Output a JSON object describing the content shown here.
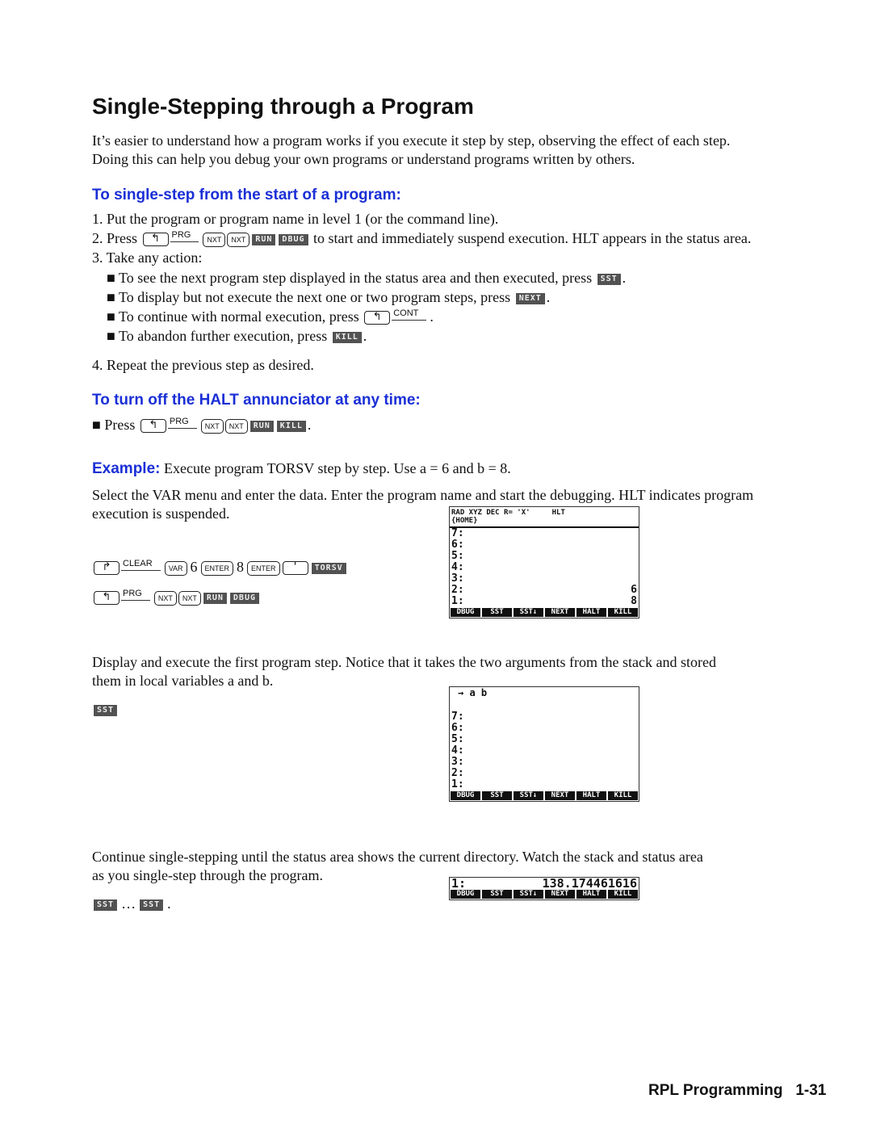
{
  "title": "Single-Stepping through a Program",
  "intro": [
    "It’s easier to understand how a program works if you execute it step by step, observing the effect of each step.",
    "Doing this can help you debug your own programs or understand programs written by others."
  ],
  "section1": {
    "heading": "To single-step from the start of a program:",
    "step1": "1. Put the program or program name in level 1 (or the command line).",
    "step2_pre": "2. Press",
    "step2_keys": [
      {
        "t": "shift",
        "v": "↰"
      },
      {
        "t": "label",
        "v": "PRG"
      },
      {
        "t": "key",
        "v": "NXT"
      },
      {
        "t": "key",
        "v": "NXT"
      },
      {
        "t": "soft",
        "v": "RUN"
      },
      {
        "t": "soft",
        "v": "DBUG"
      }
    ],
    "step2_post": "to start and immediately suspend execution. HLT appears in the status area.",
    "step3": "3. Take any action:",
    "bullets": [
      {
        "pre": "■ To see the next program step displayed in the status area and then executed, press",
        "keys": [
          {
            "t": "soft",
            "v": "SST"
          }
        ],
        "post": "."
      },
      {
        "pre": "■ To display but not execute the next one or two program steps, press",
        "keys": [
          {
            "t": "soft",
            "v": "NEXT"
          }
        ],
        "post": "."
      },
      {
        "pre": "■ To continue with normal execution, press",
        "keys": [
          {
            "t": "shift",
            "v": "↰"
          },
          {
            "t": "label",
            "v": "CONT"
          }
        ],
        "post": "."
      },
      {
        "pre": "■ To abandon further execution, press",
        "keys": [
          {
            "t": "soft",
            "v": "KILL"
          }
        ],
        "post": "."
      }
    ],
    "step4": "4.  Repeat the previous step as desired."
  },
  "section2": {
    "heading": "To turn off the HALT annunciator at any time:",
    "pre": "■ Press",
    "keys": [
      {
        "t": "shift",
        "v": "↰"
      },
      {
        "t": "label",
        "v": "PRG"
      },
      {
        "t": "key",
        "v": "NXT"
      },
      {
        "t": "key",
        "v": "NXT"
      },
      {
        "t": "soft",
        "v": "RUN"
      },
      {
        "t": "soft",
        "v": "KILL"
      }
    ],
    "post": "."
  },
  "example": {
    "label": "Example:",
    "text": "Execute program TORSV step by step. Use a = 6 and b = 8.",
    "p1": [
      "Select the VAR menu and enter the data. Enter the program name and start the debugging. HLT indicates program",
      "execution is suspended."
    ],
    "keys1": [
      {
        "t": "shift",
        "v": "↱"
      },
      {
        "t": "label",
        "v": "CLEAR"
      },
      {
        "t": "key",
        "v": "VAR"
      },
      {
        "t": "text",
        "v": "6"
      },
      {
        "t": "key",
        "v": "ENTER"
      },
      {
        "t": "text",
        "v": "8"
      },
      {
        "t": "key",
        "v": "ENTER"
      },
      {
        "t": "shift",
        "v": "'"
      },
      {
        "t": "soft",
        "v": "TORSV"
      }
    ],
    "keys2": [
      {
        "t": "shift",
        "v": "↰"
      },
      {
        "t": "label",
        "v": "PRG"
      },
      {
        "t": "key",
        "v": "NXT"
      },
      {
        "t": "key",
        "v": "NXT"
      },
      {
        "t": "soft",
        "v": "RUN"
      },
      {
        "t": "soft",
        "v": "DBUG"
      }
    ],
    "p2": [
      "Display and execute the first program step. Notice that it takes the two arguments from the stack and stored",
      "them in local variables a and b."
    ],
    "keys3": [
      {
        "t": "soft",
        "v": "SST"
      }
    ],
    "p3": [
      "Continue single-stepping until the status area shows the current directory. Watch the stack and status area",
      "as you single-step through the program."
    ],
    "keys4": [
      {
        "t": "soft",
        "v": "SST"
      },
      {
        "t": "text",
        "v": "…"
      },
      {
        "t": "soft",
        "v": "SST"
      },
      {
        "t": "text",
        "v": "."
      }
    ]
  },
  "screen1": {
    "status1": "RAD XYZ DEC R= 'X'     HLT",
    "status2": "{HOME}",
    "levels": [
      [
        "7:",
        ""
      ],
      [
        "6:",
        ""
      ],
      [
        "5:",
        ""
      ],
      [
        "4:",
        ""
      ],
      [
        "3:",
        ""
      ],
      [
        "2:",
        "6"
      ],
      [
        "1:",
        "8"
      ]
    ]
  },
  "screen2": {
    "status1": "→ a b",
    "levels": [
      [
        "7:",
        ""
      ],
      [
        "6:",
        ""
      ],
      [
        "5:",
        ""
      ],
      [
        "4:",
        ""
      ],
      [
        "3:",
        ""
      ],
      [
        "2:",
        ""
      ],
      [
        "1:",
        ""
      ]
    ]
  },
  "screen3": {
    "levels": [
      [
        "1:",
        "138.174461616"
      ]
    ]
  },
  "menu": [
    "DBUG",
    "SST",
    "SST↓",
    "NEXT",
    "HALT",
    "KILL"
  ],
  "footer": {
    "section": "RPL Programming",
    "page": "1-31"
  }
}
